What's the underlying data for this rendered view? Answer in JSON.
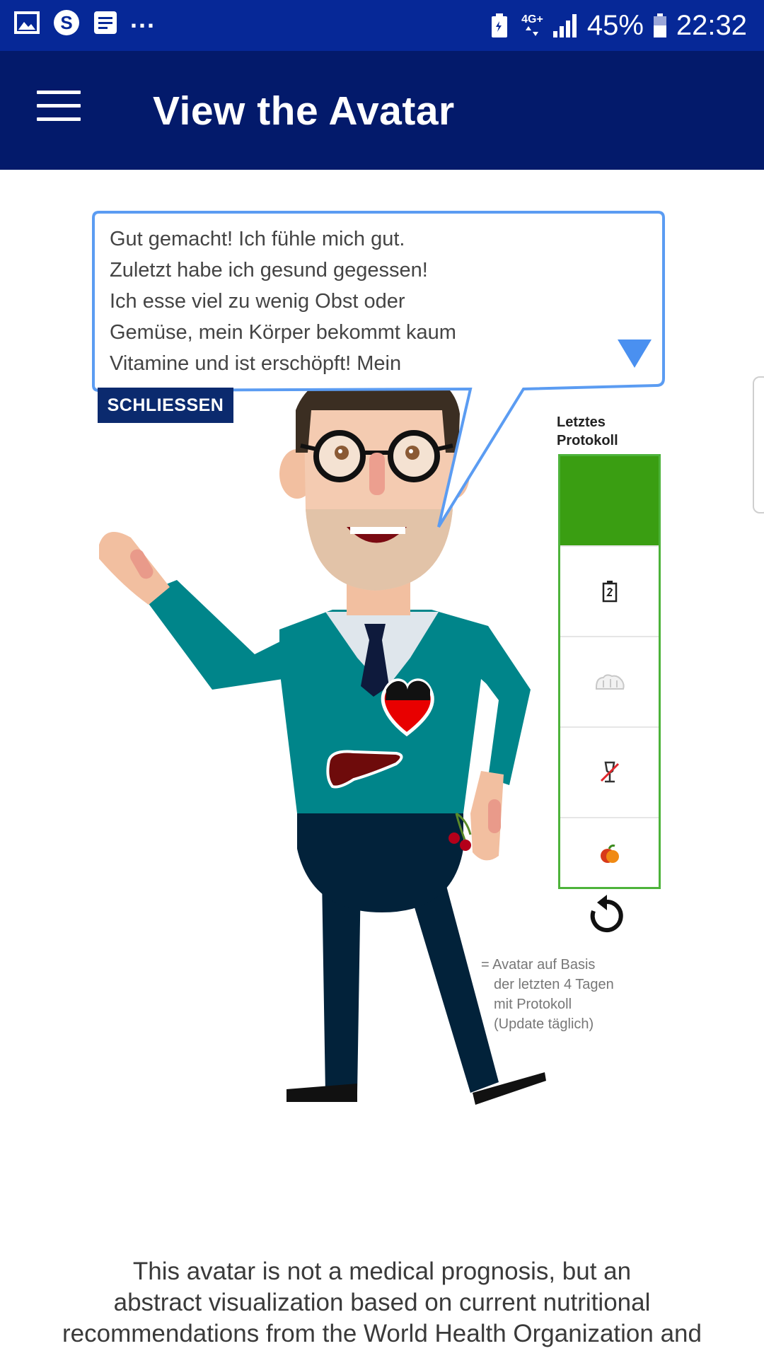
{
  "status_bar": {
    "overflow": "...",
    "network": "4G+",
    "battery": "45%",
    "time": "22:32",
    "icons": [
      "gallery-icon",
      "skype-icon",
      "notes-icon",
      "battery-saver-icon",
      "signal-icon",
      "battery-icon"
    ]
  },
  "app_bar": {
    "title": "View the Avatar",
    "menu_icon": "hamburger-menu-icon"
  },
  "speech": {
    "lines": [
      "Gut gemacht! Ich fühle mich gut.",
      "Zuletzt habe ich gesund gegessen!",
      "Ich esse viel zu wenig Obst oder",
      "Gemüse, mein Körper bekommt kaum",
      "Vitamine und ist erschöpft! Mein"
    ],
    "scroll_icon": "scroll-down-triangle-icon",
    "close_label": "SCHLIESSEN"
  },
  "panel": {
    "title_line1": "Letztes",
    "title_line2": "Protokoll",
    "mood_icon": "happy-face-icon",
    "rows": [
      "battery-level-icon",
      "bread-icon",
      "no-alcohol-icon",
      "fruit-icon"
    ],
    "refresh_icon": "refresh-icon"
  },
  "legend": {
    "line1": "= Avatar auf Basis",
    "line2": "der letzten 4 Tagen",
    "line3": "mit Protokoll",
    "line4": "(Update täglich)"
  },
  "disclaimer": {
    "line1": "This avatar is not a medical prognosis, but an",
    "line2": "abstract visualization based on current nutritional",
    "line3": "recommendations from the World Health Organization and"
  },
  "colors": {
    "status_bar": "#062897",
    "app_bar": "#031a6b",
    "panel_border": "#4db33a",
    "mood_green": "#3a9e12",
    "bubble_border": "#5b9cf2",
    "sweater": "#008a8e",
    "trousers": "#02223a"
  }
}
